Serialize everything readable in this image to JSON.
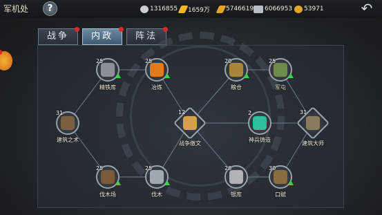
{
  "header": {
    "title": "军机处",
    "help_icon": "question-icon",
    "resources": [
      {
        "icon": "silver-icon",
        "value": "1316855",
        "color": "#c9ced2"
      },
      {
        "icon": "gold-bar-icon",
        "value": "1659万",
        "color": "#f0b52a"
      },
      {
        "icon": "gold-ingot-icon",
        "value": "5746619",
        "color": "#e8a22a"
      },
      {
        "icon": "iron-icon",
        "value": "6066953",
        "color": "#b8bfc4"
      },
      {
        "icon": "coin-icon",
        "value": "53971",
        "color": "#e3a52c"
      }
    ],
    "back_icon": "back-arrow-icon"
  },
  "tabs": [
    {
      "label": "战争",
      "active": false
    },
    {
      "label": "内政",
      "active": true
    },
    {
      "label": "阵法",
      "active": false
    }
  ],
  "nodes": [
    {
      "id": "jingtieku",
      "label": "精铁库",
      "level": "25",
      "upgrade": true,
      "art": "#8a9096"
    },
    {
      "id": "yelian",
      "label": "冶炼",
      "level": "25",
      "upgrade": true,
      "art": "#e07a1a"
    },
    {
      "id": "liangcang",
      "label": "粮仓",
      "level": "20",
      "upgrade": true,
      "art": "#a8843c"
    },
    {
      "id": "juntun",
      "label": "军屯",
      "level": "25",
      "upgrade": true,
      "art": "#6e8a4a"
    },
    {
      "id": "jianzhuzhishu",
      "label": "建筑之术",
      "level": "31",
      "upgrade": false,
      "art": "#7a6040"
    },
    {
      "id": "zhanzhengweiwen",
      "label": "战争缴文",
      "level": "12",
      "upgrade": false,
      "art": "#d4a050"
    },
    {
      "id": "shenbingzhuzao",
      "label": "神兵铸造",
      "level": "2",
      "upgrade": false,
      "art": "#2fbf9a"
    },
    {
      "id": "jianzhudashi",
      "label": "建筑大师",
      "level": "31",
      "upgrade": false,
      "art": "#8a7a60"
    },
    {
      "id": "famuchang",
      "label": "伐木场",
      "level": "25",
      "upgrade": true,
      "art": "#7a5a3a"
    },
    {
      "id": "famu",
      "label": "伐木",
      "level": "25",
      "upgrade": true,
      "art": "#a0a8b0"
    },
    {
      "id": "yinku",
      "label": "银库",
      "level": "28",
      "upgrade": false,
      "art": "#b0b4b8"
    },
    {
      "id": "koufu",
      "label": "口赋",
      "level": "30",
      "upgrade": true,
      "art": "#8a6a40"
    }
  ]
}
